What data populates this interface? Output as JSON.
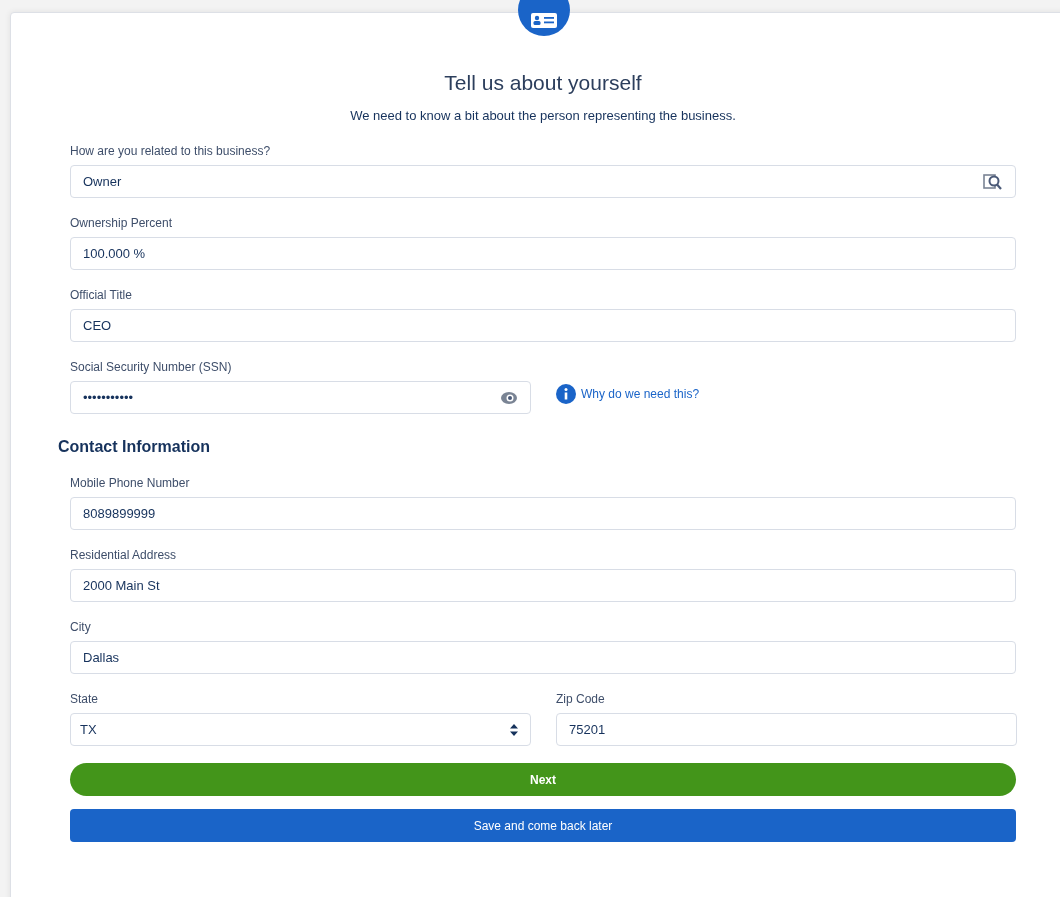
{
  "header": {
    "title": "Tell us about yourself",
    "subtitle": "We need to know a bit about the person representing the business."
  },
  "fields": [
    {
      "label": "How are you related to this business?",
      "value": "Owner",
      "kind": "lookup"
    },
    {
      "label": "Ownership Percent",
      "value": "100.000 %",
      "kind": "text"
    },
    {
      "label": "Official Title",
      "value": "CEO",
      "kind": "text"
    },
    {
      "label": "Social Security Number (SSN)",
      "value": "•••••••••••",
      "kind": "secret",
      "help": "Why do we need this?"
    }
  ],
  "contact": {
    "title": "Contact Information",
    "fields": [
      {
        "label": "Mobile Phone Number",
        "value": "8089899999"
      },
      {
        "label": "Residential Address",
        "value": "2000 Main St"
      },
      {
        "label": "City",
        "value": "Dallas"
      }
    ],
    "pair": [
      {
        "label": "State",
        "value": "TX",
        "kind": "select"
      },
      {
        "label": "Zip Code",
        "value": "75201",
        "kind": "text"
      }
    ]
  },
  "buttons": [
    {
      "label": "Next",
      "kind": "primary"
    },
    {
      "label": "Save and come back later",
      "kind": "secondary"
    }
  ]
}
